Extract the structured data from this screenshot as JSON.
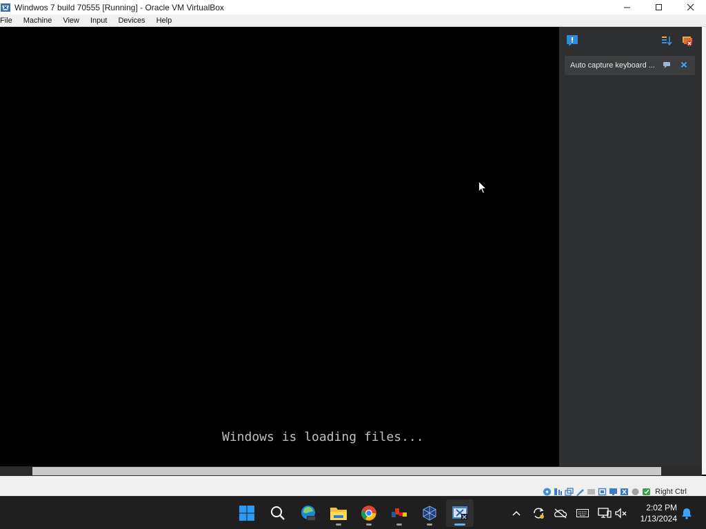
{
  "window": {
    "title": "Windwos 7 build 70555 [Running] - Oracle VM VirtualBox",
    "minimize_glyph": "—",
    "maximize_glyph": "☐",
    "close_glyph": "✕"
  },
  "menu": [
    "File",
    "Machine",
    "View",
    "Input",
    "Devices",
    "Help"
  ],
  "vm_screen": {
    "boot_message": "Windows is loading files..."
  },
  "notification_panel": {
    "message": "Auto capture keyboard ...",
    "icons": [
      "notification-center-icon",
      "sort-icon",
      "ignore-all-icon",
      "pin-icon",
      "close-icon"
    ]
  },
  "statusbar": {
    "host_key": "Right Ctrl",
    "icons": [
      "hard-disk-icon",
      "optical-drive-icon",
      "audio-icon",
      "network-icon",
      "usb-icon",
      "shared-folders-icon",
      "display-icon",
      "video-capture-icon",
      "virtualization-icon",
      "mouse-integration-icon",
      "keyboard-capture-icon"
    ]
  },
  "taskbar": {
    "apps": [
      "start-icon",
      "search-icon",
      "edge-beta-icon",
      "file-explorer-icon",
      "chrome-icon",
      "office-app-icon",
      "virtualbox-icon",
      "vm-window-icon"
    ],
    "tray_icons": [
      "show-hidden-icons-chevron",
      "sync-icon",
      "onedrive-offline-icon",
      "keyboard-icon",
      "display-network-icon",
      "volume-muted-icon",
      "notification-bell-icon"
    ],
    "time": "2:02 PM",
    "date": "1/13/2024"
  },
  "colors": {
    "accent": "#0078d4",
    "panel_bg": "#2d2f30",
    "taskbar_bg": "#1f1f1f"
  }
}
